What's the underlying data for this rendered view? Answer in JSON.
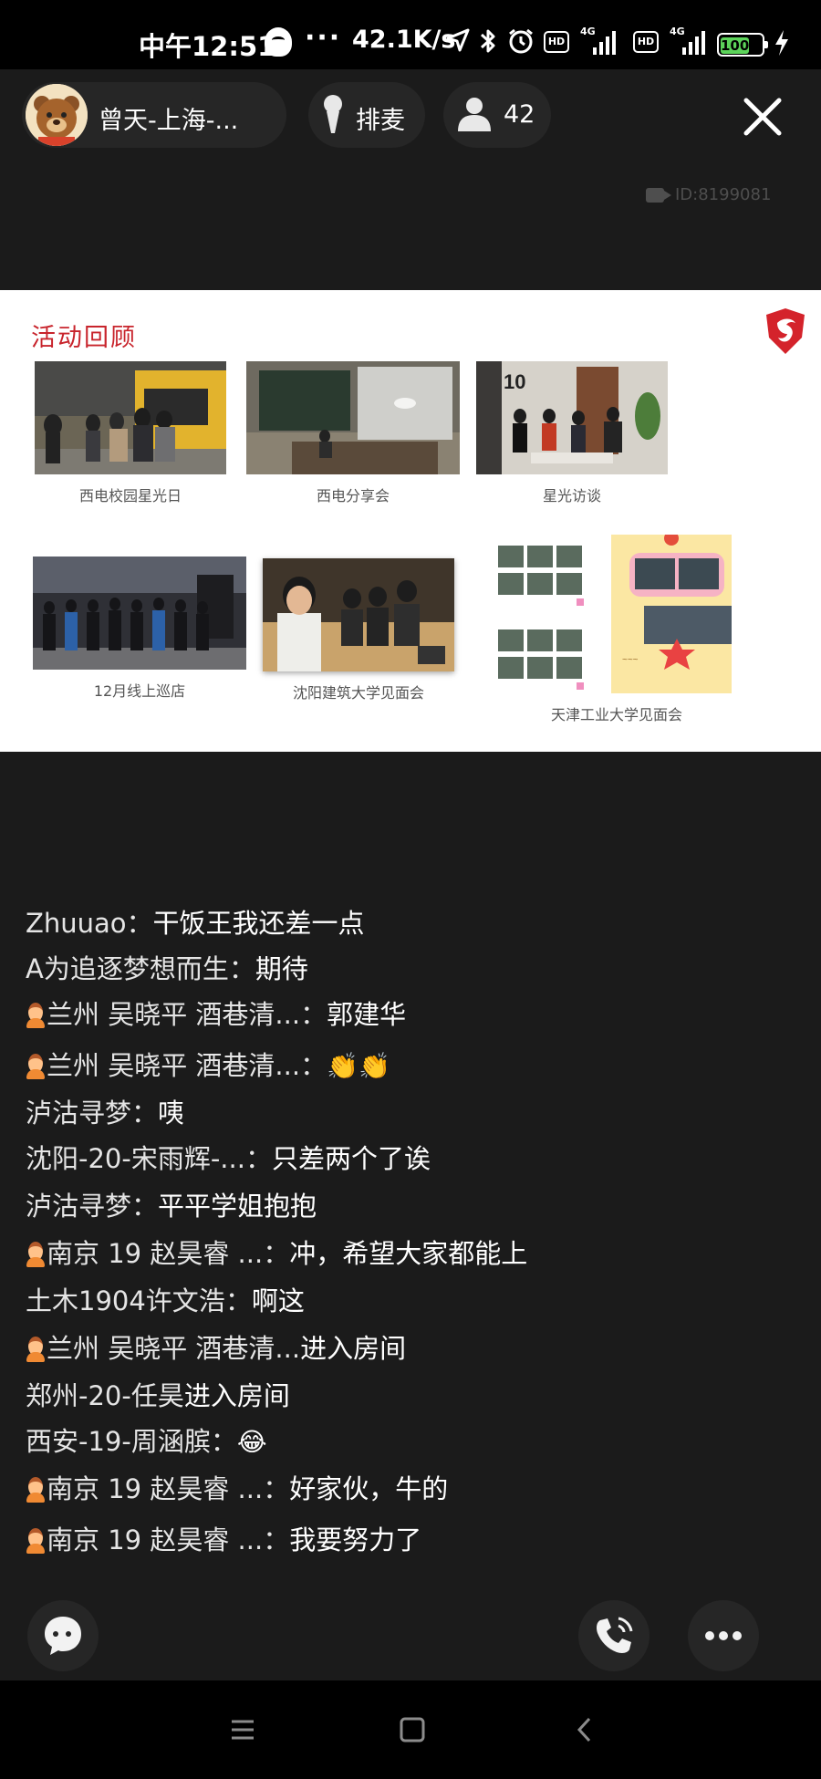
{
  "status_bar": {
    "time": "中午12:51",
    "dots": "···",
    "speed": "42.1K/s",
    "hd_label": "HD",
    "network_label": "4G",
    "battery": "100"
  },
  "room": {
    "host_name": "曾天-上海-...",
    "mic_label": "排麦",
    "viewer_count": "42",
    "room_id": "ID:8199081"
  },
  "slide": {
    "title": "活动回顾",
    "photos": [
      {
        "caption": "西电校园星光日"
      },
      {
        "caption": "西电分享会"
      },
      {
        "caption": "星光访谈"
      },
      {
        "caption": "12月线上巡店"
      },
      {
        "caption": "沈阳建筑大学见面会"
      },
      {
        "caption": "天津工业大学见面会"
      }
    ]
  },
  "chat": [
    {
      "user": "Zhuuao",
      "sep": "：",
      "text": "干饭王我还差一点",
      "badge": false
    },
    {
      "user": "A为追逐梦想而生",
      "sep": "：",
      "text": "期待",
      "badge": false
    },
    {
      "user": "兰州 吴晓平 酒巷清...",
      "sep": "：",
      "text": "郭建华",
      "badge": true
    },
    {
      "user": "兰州 吴晓平 酒巷清...",
      "sep": "：",
      "text": "",
      "badge": true,
      "emoji": "👏👏"
    },
    {
      "user": "泸沽寻梦",
      "sep": "：",
      "text": "咦",
      "badge": false
    },
    {
      "user": "沈阳-20-宋雨辉-...",
      "sep": "：",
      "text": "只差两个了诶",
      "badge": false
    },
    {
      "user": "泸沽寻梦",
      "sep": "：",
      "text": "平平学姐抱抱",
      "badge": false
    },
    {
      "user": "南京 19 赵昊睿 ...",
      "sep": "：",
      "text": "冲，希望大家都能上",
      "badge": true
    },
    {
      "user": "土木1904许文浩",
      "sep": "：",
      "text": "啊这",
      "badge": false
    },
    {
      "user": "兰州 吴晓平 酒巷清...",
      "sep": "",
      "text": "进入房间",
      "badge": true
    },
    {
      "user": "郑州-20-任昊",
      "sep": "",
      "text": "进入房间",
      "badge": false
    },
    {
      "user": "西安-19-周涵膑",
      "sep": "：",
      "text": "",
      "badge": false,
      "emoji": "😂"
    },
    {
      "user": "南京 19 赵昊睿 ...",
      "sep": "：",
      "text": "好家伙，牛的",
      "badge": true
    },
    {
      "user": "南京 19 赵昊睿 ...",
      "sep": "：",
      "text": "我要努力了",
      "badge": true
    }
  ],
  "colors": {
    "background": "#1b1b1b",
    "slide_title": "#c8242c",
    "battery": "#5cd35a",
    "pill": "#262626"
  },
  "icons": [
    "qq-icon",
    "location-arrow-icon",
    "bluetooth-icon",
    "alarm-icon",
    "signal-icon",
    "battery-icon",
    "charging-icon",
    "mic-icon",
    "person-icon",
    "close-icon",
    "camera-icon",
    "msi-dragon-logo",
    "chat-bubble-icon",
    "phone-icon",
    "more-dots-icon",
    "menu-icon",
    "home-square-icon",
    "back-chevron-icon"
  ]
}
